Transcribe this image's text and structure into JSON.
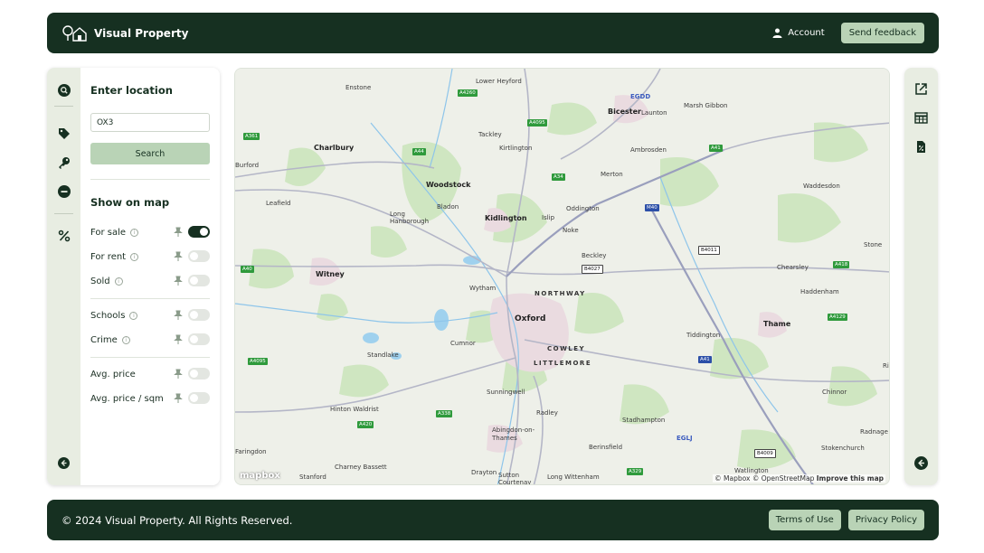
{
  "header": {
    "brand": "Visual Property",
    "account_label": "Account",
    "feedback_label": "Send feedback"
  },
  "sidebar": {
    "rail_icons": [
      "search-icon",
      "tag-icon",
      "key-icon",
      "minus-circle-icon",
      "percent-icon",
      "collapse-left-icon"
    ],
    "location_heading": "Enter location",
    "location_value": "OX3",
    "search_label": "Search",
    "show_heading": "Show on map",
    "options": [
      {
        "label": "For sale",
        "on": true
      },
      {
        "label": "For rent",
        "on": false
      },
      {
        "label": "Sold",
        "on": false
      },
      {
        "label": "Schools",
        "on": false
      },
      {
        "label": "Crime",
        "on": false
      },
      {
        "label": "Avg. price",
        "on": false
      },
      {
        "label": "Avg. price / sqm",
        "on": false
      }
    ]
  },
  "map": {
    "places": [
      {
        "name": "Enstone"
      },
      {
        "name": "Lower Heyford"
      },
      {
        "name": "EGDD"
      },
      {
        "name": "Bicester"
      },
      {
        "name": "Launton"
      },
      {
        "name": "Marsh Gibbon"
      },
      {
        "name": "Charlbury"
      },
      {
        "name": "Tackley"
      },
      {
        "name": "Kirtlington"
      },
      {
        "name": "Ambrosden"
      },
      {
        "name": "Woodstock"
      },
      {
        "name": "Merton"
      },
      {
        "name": "Leafield"
      },
      {
        "name": "Bladon"
      },
      {
        "name": "Long Hanborough"
      },
      {
        "name": "Kidlington"
      },
      {
        "name": "Islip"
      },
      {
        "name": "Oddington"
      },
      {
        "name": "Waddesdon"
      },
      {
        "name": "Noke"
      },
      {
        "name": "Beckley"
      },
      {
        "name": "Stone"
      },
      {
        "name": "Witney"
      },
      {
        "name": "Wytham"
      },
      {
        "name": "NORTHWAY"
      },
      {
        "name": "Chearsley"
      },
      {
        "name": "Haddenham"
      },
      {
        "name": "Oxford"
      },
      {
        "name": "Thame"
      },
      {
        "name": "Cumnor"
      },
      {
        "name": "COWLEY"
      },
      {
        "name": "Tiddington"
      },
      {
        "name": "Standlake"
      },
      {
        "name": "LITTLEMORE"
      },
      {
        "name": "Sunningwell"
      },
      {
        "name": "Chinnor"
      },
      {
        "name": "Hinton Waldrist"
      },
      {
        "name": "Radley"
      },
      {
        "name": "Stadhampton"
      },
      {
        "name": "EGLJ"
      },
      {
        "name": "Abingdon-on-Thames"
      },
      {
        "name": "Berinsfield"
      },
      {
        "name": "Radnage"
      },
      {
        "name": "Stokenchurch"
      },
      {
        "name": "Charney Bassett"
      },
      {
        "name": "Drayton"
      },
      {
        "name": "Sutton Courtenay"
      },
      {
        "name": "Long Wittenham"
      },
      {
        "name": "Watlington"
      },
      {
        "name": "Stanford"
      },
      {
        "name": "Faringdon"
      },
      {
        "name": "Burford"
      },
      {
        "name": "Ri"
      }
    ],
    "roads": [
      "A4260",
      "A4095",
      "A361",
      "A44",
      "A41",
      "A34",
      "M40",
      "B4011",
      "B4027",
      "A418",
      "A40",
      "A4129",
      "A4095",
      "A420",
      "A338",
      "A329",
      "B4009",
      "A41"
    ],
    "logo": "mapbox",
    "attribution_1": "© Mapbox",
    "attribution_2": "© OpenStreetMap",
    "attribution_3": "Improve this map"
  },
  "right_rail": {
    "icons": [
      "external-link-icon",
      "table-icon",
      "document-percent-icon",
      "collapse-left-icon"
    ]
  },
  "footer": {
    "copyright": "© 2024 Visual Property. All Rights Reserved.",
    "terms_label": "Terms of Use",
    "privacy_label": "Privacy Policy"
  }
}
